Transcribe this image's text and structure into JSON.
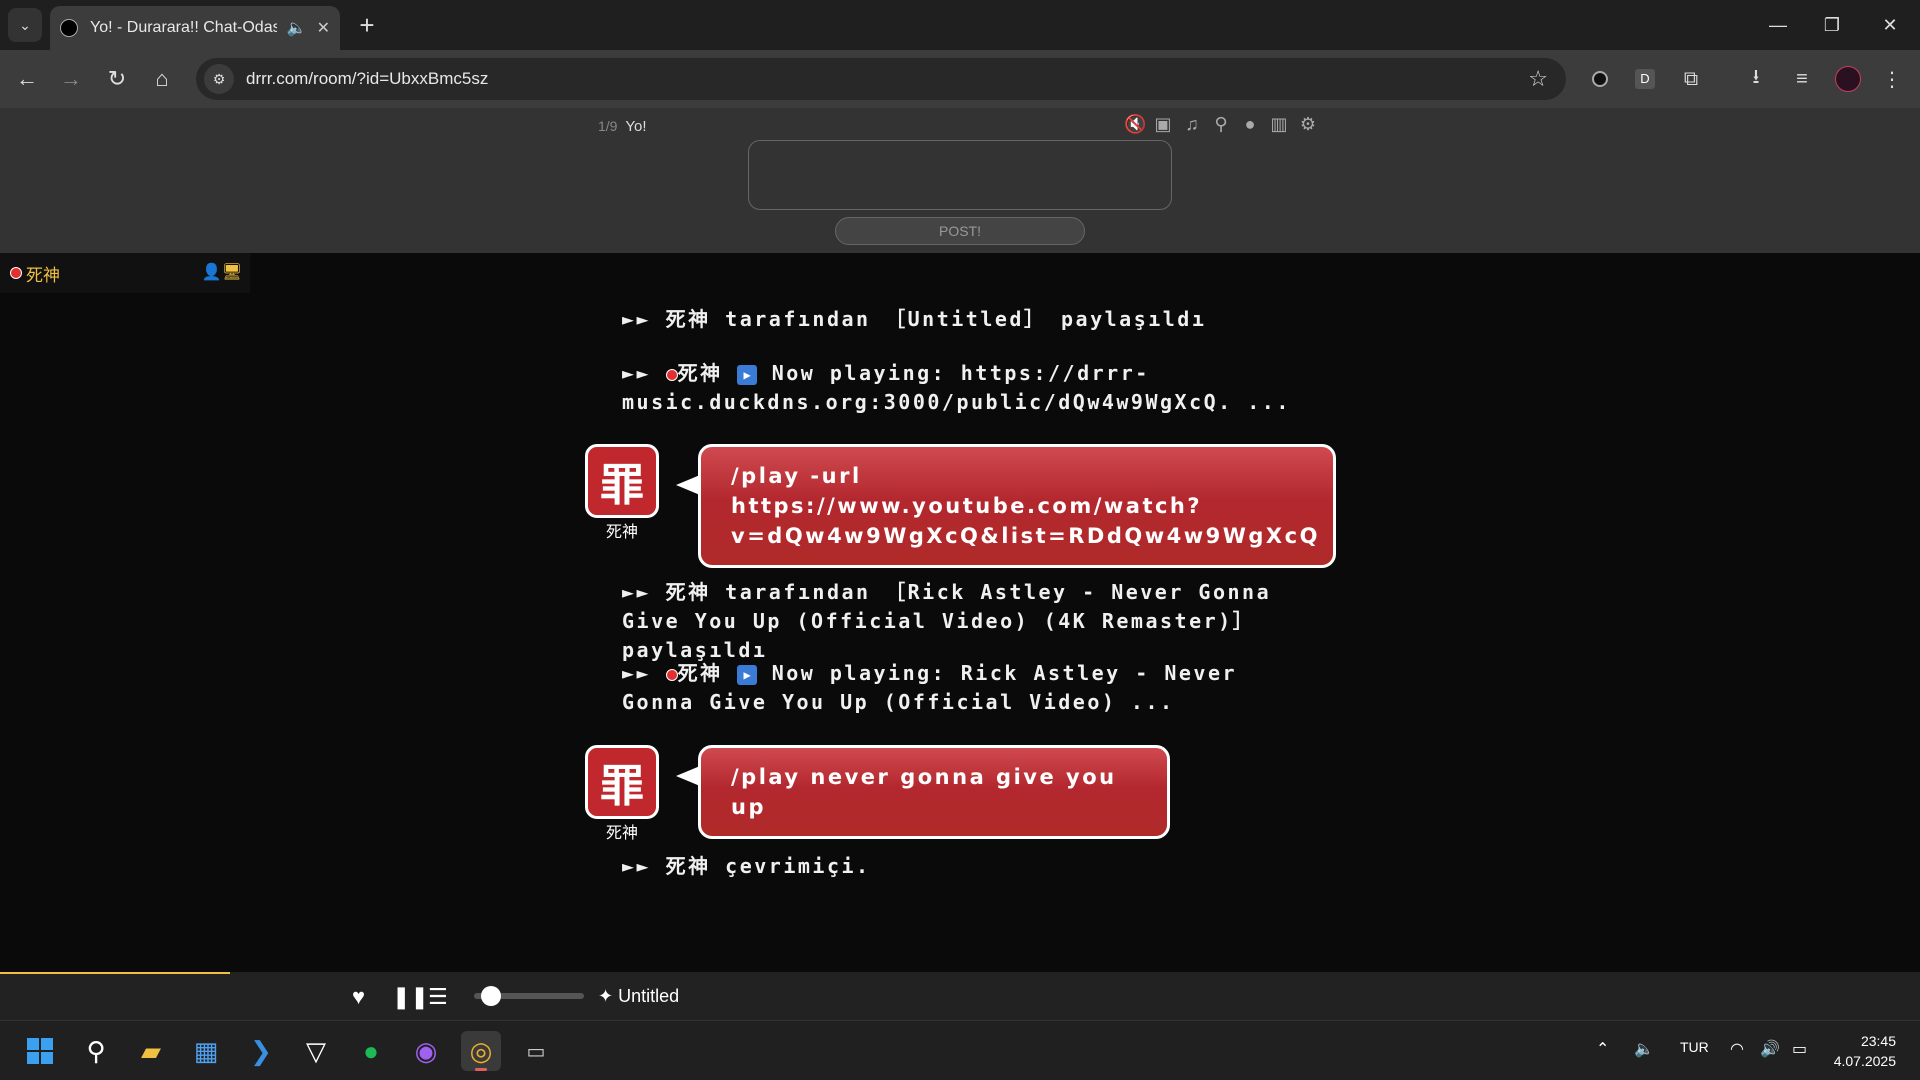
{
  "browser": {
    "tab_title": "Yo! - Durarara!! Chat-Odası",
    "audio_icon": "speaker-icon",
    "close_icon": "close-icon",
    "new_tab_icon": "plus-icon",
    "url": "drrr.com/room/?id=UbxxBmc5sz"
  },
  "room": {
    "count": "1/9",
    "name": "Yo!",
    "post_label": "POST!",
    "tools": [
      "mute-icon",
      "image-icon",
      "music-icon",
      "search-icon",
      "user-icon",
      "gift-icon",
      "gear-icon"
    ]
  },
  "user": {
    "name": "死神"
  },
  "chat": {
    "system1": "►► 死神 tarafından ［Untitled］ paylaşıldı",
    "system2_prefix": "►► ",
    "system2_name": "死神",
    "system2_text": " Now playing: https://drrr-music.duckdns.org:3000/public/dQw4w9WgXcQ. ...",
    "bubble1_author": "死神",
    "bubble1_text": "/play -url https://www.youtube.com/watch?v=dQw4w9WgXcQ&list=RDdQw4w9WgXcQ",
    "system3": "►► 死神 tarafından ［Rick Astley - Never Gonna Give You Up (Official Video) (4K Remaster)］ paylaşıldı",
    "system4_prefix": "►► ",
    "system4_name": "死神",
    "system4_text": " Now playing: Rick Astley - Never Gonna Give You Up (Official Video) ...",
    "bubble2_author": "死神",
    "bubble2_text": "/play never gonna give you up",
    "system5": "►► 死神 çevrimiçi.",
    "avatar_glyph": "罪"
  },
  "player": {
    "track": "Untitled",
    "progress": 0.12,
    "volume": 0.1
  },
  "taskbar": {
    "lang": "TUR",
    "time": "23:45",
    "date": "4.07.2025"
  }
}
